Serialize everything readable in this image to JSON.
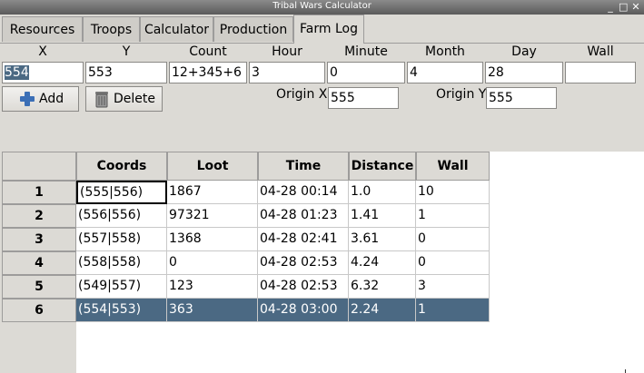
{
  "window": {
    "title": "Tribal Wars Calculator",
    "buttons": [
      "_",
      "□",
      "✕"
    ]
  },
  "tabs": [
    "Resources",
    "Troops",
    "Calculator",
    "Production",
    "Farm Log"
  ],
  "active_tab": "Farm Log",
  "form": {
    "labels": {
      "x": "X",
      "y": "Y",
      "count": "Count",
      "hour": "Hour",
      "minute": "Minute",
      "month": "Month",
      "day": "Day",
      "wall": "Wall"
    },
    "values": {
      "x": "554",
      "y": "553",
      "count": "12+345+6",
      "hour": "3",
      "minute": "0",
      "month": "4",
      "day": "28",
      "wall": ""
    },
    "add_button": "Add",
    "delete_button": "Delete",
    "origin_x_label": "Origin X",
    "origin_x": "555",
    "origin_y_label": "Origin Y",
    "origin_y": "555"
  },
  "table": {
    "columns": [
      "Coords",
      "Loot",
      "Time",
      "Distance",
      "Wall"
    ],
    "rows": [
      {
        "n": "1",
        "cells": [
          "(555|556)",
          "1867",
          "04-28 00:14",
          "1.0",
          "10"
        ]
      },
      {
        "n": "2",
        "cells": [
          "(556|556)",
          "97321",
          "04-28 01:23",
          "1.41",
          "1"
        ]
      },
      {
        "n": "3",
        "cells": [
          "(557|558)",
          "1368",
          "04-28 02:41",
          "3.61",
          "0"
        ]
      },
      {
        "n": "4",
        "cells": [
          "(558|558)",
          "0",
          "04-28 02:53",
          "4.24",
          "0"
        ]
      },
      {
        "n": "5",
        "cells": [
          "(549|557)",
          "123",
          "04-28 02:53",
          "6.32",
          "3"
        ]
      },
      {
        "n": "6",
        "cells": [
          "(554|553)",
          "363",
          "04-28 03:00",
          "2.24",
          "1"
        ]
      }
    ],
    "selected_row": 6
  }
}
